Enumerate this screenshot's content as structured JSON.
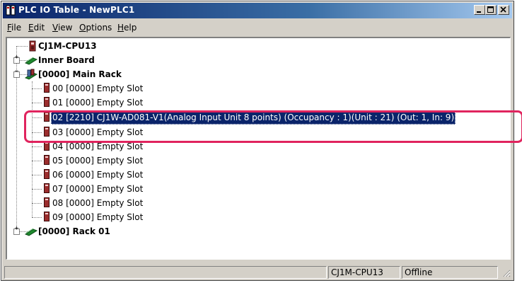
{
  "window": {
    "title": "PLC IO Table - NewPLC1",
    "minimize_label": "minimize",
    "maximize_label": "maximize",
    "close_label": "close"
  },
  "menu": [
    "File",
    "Edit",
    "View",
    "Options",
    "Help"
  ],
  "menu_mnemonics": [
    "F",
    "E",
    "V",
    "O",
    "H"
  ],
  "tree": {
    "cpu": "CJ1M-CPU13",
    "inner_board": "Inner Board",
    "main_rack": "[0000] Main Rack",
    "slots": [
      "00 [0000] Empty Slot",
      "01 [0000] Empty Slot",
      "02 [2210] CJ1W-AD081-V1(Analog Input Unit 8 points) (Occupancy : 1)(Unit : 21) (Out: 1, In: 9)",
      "03 [0000] Empty Slot",
      "04 [0000] Empty Slot",
      "05 [0000] Empty Slot",
      "06 [0000] Empty Slot",
      "07 [0000] Empty Slot",
      "08 [0000] Empty Slot",
      "09 [0000] Empty Slot"
    ],
    "rack01": "[0000] Rack 01",
    "selected_slot_index": 2
  },
  "status": {
    "cpu": "CJ1M-CPU13",
    "mode": "Offline"
  },
  "colors": {
    "highlight": "#e0245e",
    "selection": "#0a246a",
    "board_green": "#1e8a2e"
  },
  "icons": {
    "plc": "plc-unit-icon",
    "board": "board-icon",
    "rack": "rack-icon"
  }
}
